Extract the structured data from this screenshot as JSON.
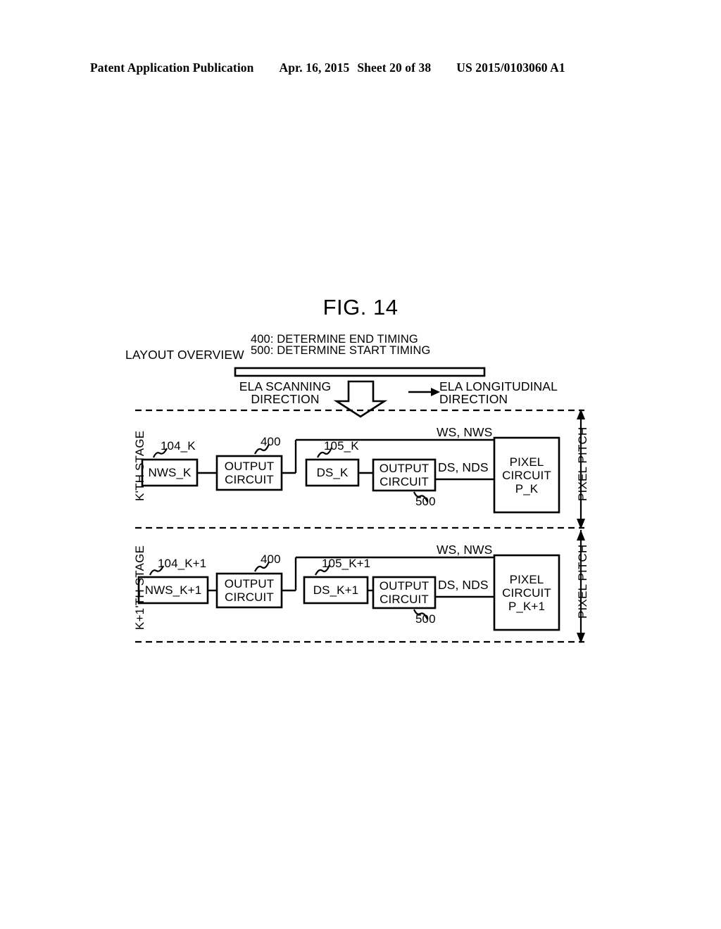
{
  "header": {
    "publication": "Patent Application Publication",
    "date": "Apr. 16, 2015",
    "sheet": "Sheet 20 of 38",
    "number": "US 2015/0103060 A1"
  },
  "figure": {
    "title": "FIG. 14",
    "overview_label": "LAYOUT OVERVIEW",
    "legend": [
      "400: DETERMINE END TIMING",
      "500: DETERMINE START TIMING"
    ],
    "ela": {
      "scanning_direction": "ELA SCANNING\nDIRECTION",
      "longitudinal_direction": "ELA LONGITUDINAL\nDIRECTION"
    },
    "stages": [
      {
        "stage_label": "K'TH STAGE",
        "ref_nws": "104_K",
        "ref_output_end": "400",
        "ref_ds": "105_K",
        "ref_output_start": "500",
        "nws_box": "NWS_K",
        "output_box_1": "OUTPUT\nCIRCUIT",
        "ds_box": "DS_K",
        "output_box_2": "OUTPUT\nCIRCUIT",
        "signal_top": "WS, NWS",
        "signal_bottom": "DS, NDS",
        "pixel_box": "PIXEL\nCIRCUIT\nP_K",
        "pitch_label": "PIXEL PITCH"
      },
      {
        "stage_label": "K+1'TH STAGE",
        "ref_nws": "104_K+1",
        "ref_output_end": "400",
        "ref_ds": "105_K+1",
        "ref_output_start": "500",
        "nws_box": "NWS_K+1",
        "output_box_1": "OUTPUT\nCIRCUIT",
        "ds_box": "DS_K+1",
        "output_box_2": "OUTPUT\nCIRCUIT",
        "signal_top": "WS, NWS",
        "signal_bottom": "DS, NDS",
        "pixel_box": "PIXEL\nCIRCUIT\nP_K+1",
        "pitch_label": "PIXEL PITCH"
      }
    ]
  },
  "colors": {
    "ink": "#000000",
    "paper": "#ffffff"
  }
}
